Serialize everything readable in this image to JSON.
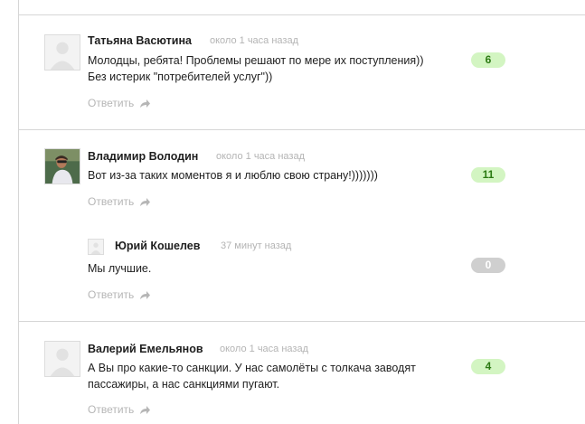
{
  "colors": {
    "positive_bg": "#d3f5c2",
    "positive_text": "#2c7a13",
    "neutral_bg": "#cfcfcf",
    "meta_text": "#b4b4b4"
  },
  "comments": [
    {
      "author": "Татьяна Васютина",
      "time": "около 1 часа назад",
      "text_lines": [
        "Молодцы, ребята! Проблемы решают по мере их поступления))",
        "Без истерик \"потребителей услуг\"))"
      ],
      "reply": "Ответить",
      "votes": "6",
      "avatar": "default-avatar-icon"
    },
    {
      "author": "Владимир Володин",
      "time": "около 1 часа назад",
      "text_lines": [
        "Вот из-за таких моментов я и люблю свою страну!)))))))"
      ],
      "reply": "Ответить",
      "votes": "11",
      "avatar": "user-photo"
    },
    {
      "author": "Юрий Кошелев",
      "time": "37 минут назад",
      "text_lines": [
        "Мы лучшие."
      ],
      "reply": "Ответить",
      "votes": "0",
      "avatar": "default-avatar-icon"
    },
    {
      "author": "Валерий Емельянов",
      "time": "около 1 часа назад",
      "text_lines": [
        "А Вы про какие-то санкции. У нас самолёты с толкача заводят",
        "пассажиры, а нас санкциями пугают."
      ],
      "reply": "Ответить",
      "votes": "4",
      "avatar": "default-avatar-icon"
    }
  ]
}
